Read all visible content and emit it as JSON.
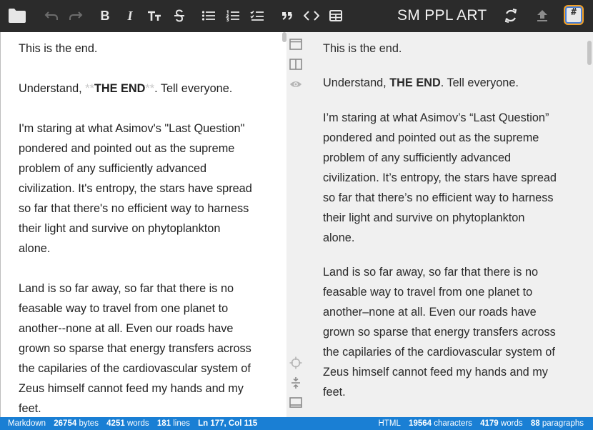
{
  "toolbar": {
    "document_title": "SM PPL ART",
    "badge_glyph": "#",
    "buttons": [
      {
        "name": "folder-icon"
      },
      {
        "name": "undo-icon"
      },
      {
        "name": "redo-icon"
      },
      {
        "name": "bold-icon",
        "glyph": "B"
      },
      {
        "name": "italic-icon",
        "glyph": "I"
      },
      {
        "name": "heading-icon"
      },
      {
        "name": "strikethrough-icon"
      },
      {
        "name": "unordered-list-icon"
      },
      {
        "name": "ordered-list-icon"
      },
      {
        "name": "checklist-icon"
      },
      {
        "name": "blockquote-icon"
      },
      {
        "name": "code-icon"
      },
      {
        "name": "table-icon"
      },
      {
        "name": "sync-icon"
      },
      {
        "name": "publish-icon"
      }
    ]
  },
  "editor": {
    "lines": [
      "This is the end.",
      "",
      [
        "Understand, ",
        {
          "mark": "**"
        },
        {
          "strong": "THE END"
        },
        {
          "mark": "**"
        },
        ".  Tell everyone."
      ],
      "",
      "I'm staring at what Asimov's \"Last Question\"",
      "pondered and pointed out as the supreme",
      "problem of any sufficiently advanced",
      "civilization.  It's entropy, the stars have spread",
      "so far that there's no efficient way to harness",
      "their light and survive on phytoplankton",
      "alone.",
      "",
      "Land is so far away, so far that there is no",
      "feasable way to travel from one planet to",
      "another--none at all.  Even our roads have",
      "grown so sparse that energy transfers across",
      "the capilaries of the cardiovascular system of",
      "Zeus himself cannot feed my hands and my",
      "feet."
    ]
  },
  "preview": {
    "paragraphs": [
      [
        "This is the end."
      ],
      [
        [
          "Understand, ",
          {
            "strong": "THE END"
          },
          ". Tell everyone."
        ]
      ],
      [
        "I’m staring at what Asimov’s “Last Question”",
        "pondered and pointed out as the supreme",
        "problem of any sufficiently advanced",
        "civilization. It’s entropy, the stars have spread",
        "so far that there’s no efficient way to harness",
        "their light and survive on phytoplankton",
        "alone."
      ],
      [
        "Land is so far away, so far that there is no",
        "feasable way to travel from one planet to",
        "another–none at all. Even our roads have",
        "grown so sparse that energy transfers across",
        "the capilaries of the cardiovascular system of",
        "Zeus himself cannot feed my hands and my",
        "feet."
      ]
    ]
  },
  "rail": {
    "top_buttons": [
      "editor-only-icon",
      "split-view-icon",
      "preview-eye-icon"
    ],
    "bottom_buttons": [
      "sync-scroll-icon",
      "fit-width-icon",
      "distraction-free-icon"
    ]
  },
  "status": {
    "left": {
      "mode": "Markdown",
      "bytes_value": "26754",
      "bytes_label": "bytes",
      "words_value": "4251",
      "words_label": "words",
      "lines_value": "181",
      "lines_label": "lines",
      "cursor": "Ln 177, Col 115"
    },
    "right": {
      "mode": "HTML",
      "chars_value": "19564",
      "chars_label": "characters",
      "words_value": "4179",
      "words_label": "words",
      "paras_value": "88",
      "paras_label": "paragraphs"
    }
  },
  "colors": {
    "toolbar_bg": "#2b2b2b",
    "status_bg": "#1a7fd4",
    "preview_bg": "#f0f0f0",
    "markdown_mark": "#c9c9c9",
    "badge_orange": "#f4a125",
    "badge_blue": "#4a7fd4"
  }
}
